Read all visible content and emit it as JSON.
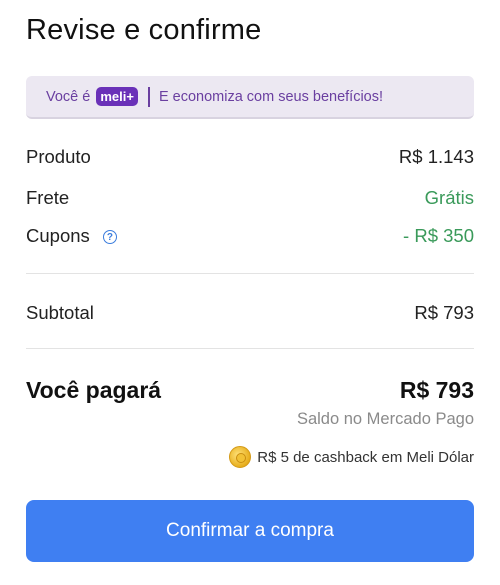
{
  "header": {
    "title": "Revise e confirme"
  },
  "banner": {
    "prefix": "Você é",
    "badge": "meli+",
    "text": "E economiza com seus benefícios!"
  },
  "summary": {
    "product_label": "Produto",
    "product_value": "R$ 1.143",
    "shipping_label": "Frete",
    "shipping_value": "Grátis",
    "coupons_label": "Cupons",
    "coupons_value": "- R$ 350",
    "subtotal_label": "Subtotal",
    "subtotal_value": "R$ 793"
  },
  "payment": {
    "label": "Você pagará",
    "amount": "R$ 793",
    "source": "Saldo no Mercado Pago",
    "cashback": "R$ 5 de cashback em Meli Dólar"
  },
  "actions": {
    "confirm_label": "Confirmar a compra"
  },
  "colors": {
    "accent": "#3f7ff2",
    "success": "#3a9a5a",
    "brand": "#6a31b8"
  }
}
